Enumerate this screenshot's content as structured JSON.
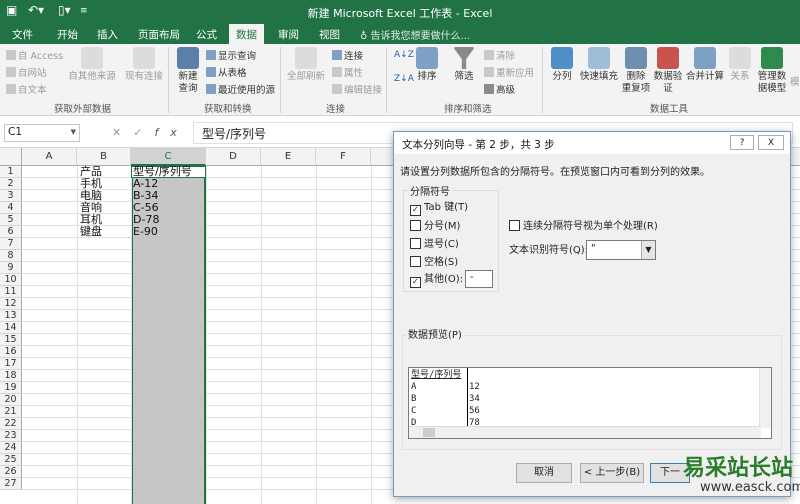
{
  "window": {
    "title": "新建 Microsoft Excel 工作表 - Excel"
  },
  "tabs": [
    "文件",
    "开始",
    "插入",
    "页面布局",
    "公式",
    "数据",
    "审阅",
    "视图"
  ],
  "tell_me": "告诉我您想要做什么...",
  "ribbon": {
    "get_external": {
      "access": "自 Access",
      "web": "自网站",
      "text": "自文本",
      "other": "自其他来源",
      "existing": "现有连接",
      "label": "获取外部数据"
    },
    "get_transform": {
      "new_query": "新建\n查询",
      "show_query": "显示查询",
      "from_table": "从表格",
      "recent": "最近使用的源",
      "label": "获取和转换"
    },
    "connections": {
      "refresh_all": "全部刷新",
      "connections": "连接",
      "properties": "属性",
      "edit_links": "编辑链接",
      "label": "连接"
    },
    "sort_filter": {
      "az": "A↓Z",
      "za": "Z↓A",
      "sort": "排序",
      "filter": "筛选",
      "clear": "清除",
      "reapply": "重新应用",
      "advanced": "高级",
      "label": "排序和筛选"
    },
    "data_tools": {
      "split": "分列",
      "flash_fill": "快速填充",
      "remove_dup": "删除\n重复项",
      "validation": "数据验\n证",
      "consolidate": "合并计算",
      "relations": "关系",
      "model": "管理数\n据模型",
      "more": "模",
      "label": "数据工具"
    }
  },
  "formula_bar": {
    "cell_ref": "C1",
    "content": "型号/序列号"
  },
  "columns": [
    "A",
    "B",
    "C",
    "D",
    "E",
    "F"
  ],
  "rows": [
    "1",
    "2",
    "3",
    "4",
    "5",
    "6",
    "7",
    "8",
    "9",
    "10",
    "11",
    "12",
    "13",
    "14",
    "15",
    "16",
    "17",
    "18",
    "19",
    "20",
    "21",
    "22",
    "23",
    "24",
    "25",
    "26",
    "27"
  ],
  "cells": {
    "b": [
      "产品",
      "手机",
      "电脑",
      "音响",
      "耳机",
      "键盘"
    ],
    "c": [
      "型号/序列号",
      "A-12",
      "B-34",
      "C-56",
      "D-78",
      "E-90"
    ]
  },
  "dialog": {
    "title": "文本分列向导 - 第 2 步，共 3 步",
    "help": "?",
    "close": "X",
    "instruction": "请设置分列数据所包含的分隔符号。在预览窗口内可看到分列的效果。",
    "delimiters_label": "分隔符号",
    "delimiters": [
      {
        "label": "Tab 键(T)",
        "checked": true
      },
      {
        "label": "分号(M)",
        "checked": false
      },
      {
        "label": "逗号(C)",
        "checked": false
      },
      {
        "label": "空格(S)",
        "checked": false
      },
      {
        "label": "其他(O):",
        "checked": true
      }
    ],
    "other_value": "-",
    "consecutive": "连续分隔符号视为单个处理(R)",
    "qualifier_label": "文本识别符号(Q):",
    "qualifier_value": "\"",
    "preview_label": "数据预览(P)",
    "preview_col1": [
      "型号/序列号",
      "A",
      "B",
      "C",
      "D"
    ],
    "preview_col2": [
      "",
      "12",
      "34",
      "56",
      "78"
    ],
    "buttons": {
      "cancel": "取消",
      "back": "< 上一步(B)",
      "next": "下一"
    }
  },
  "watermark": {
    "name": "易采站长站",
    "url": "www.easck.com"
  },
  "colors": {
    "excel_green": "#217346",
    "selection": "#c6c6c6"
  }
}
